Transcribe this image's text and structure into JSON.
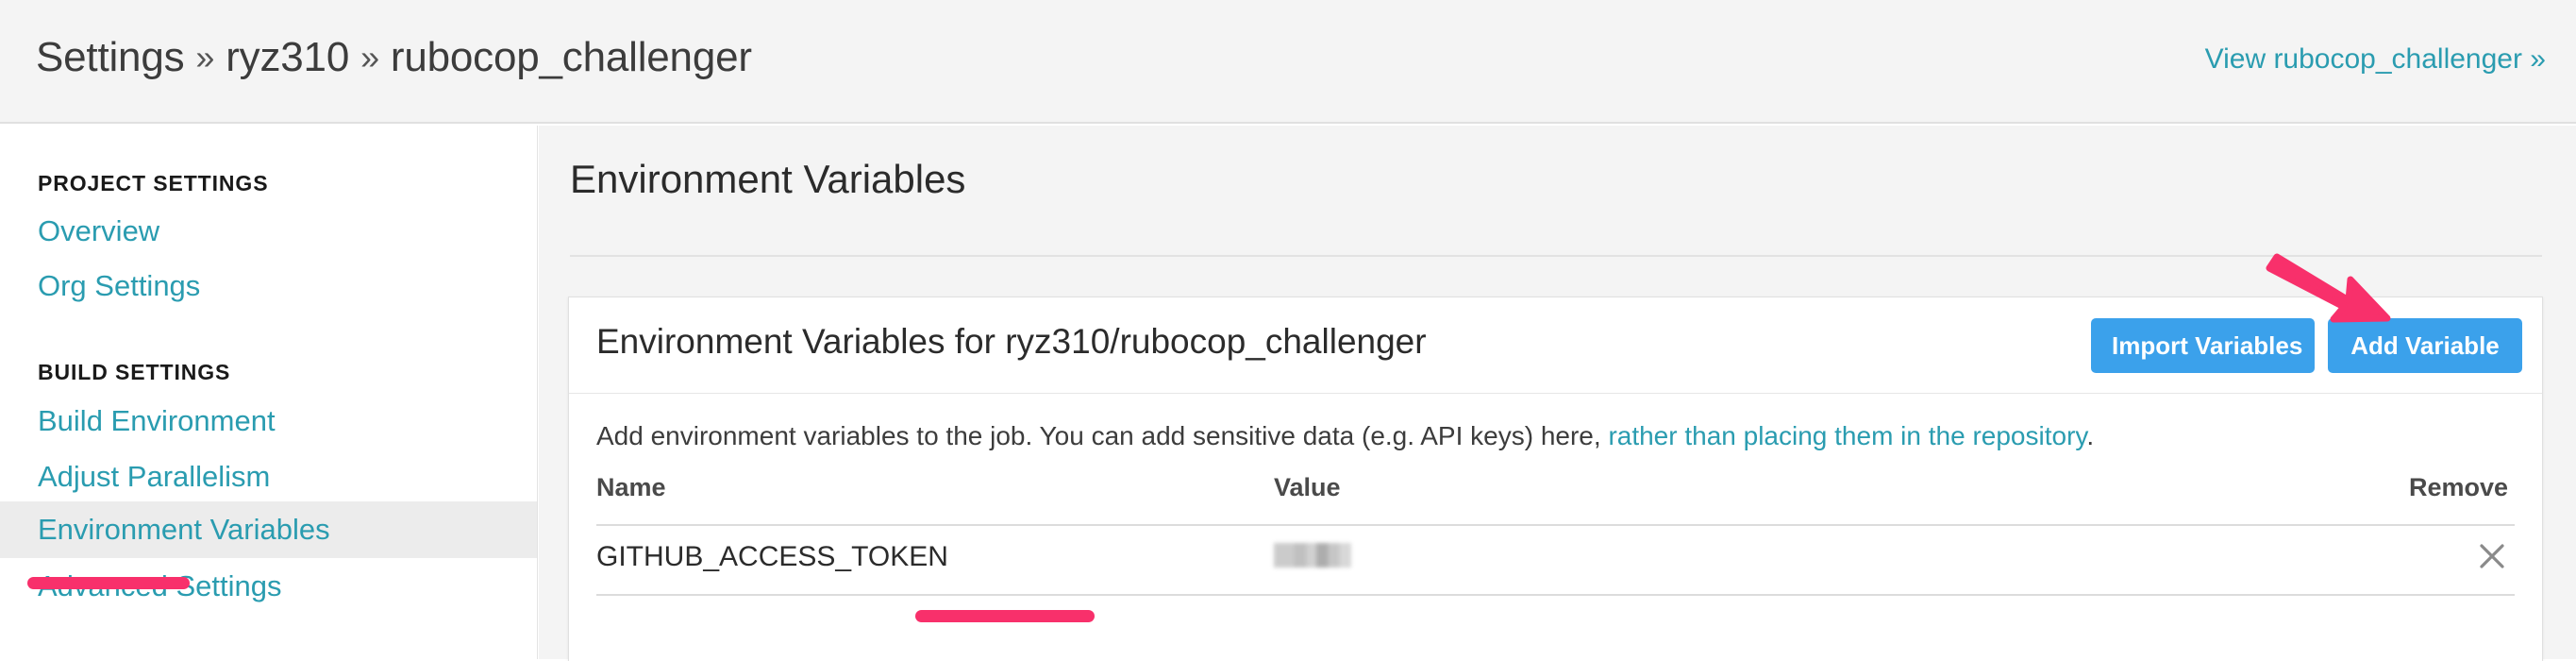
{
  "header": {
    "breadcrumb": {
      "items": [
        "Settings",
        "ryz310",
        "rubocop_challenger"
      ],
      "separator": "»"
    },
    "view_link": "View rubocop_challenger »"
  },
  "sidebar": {
    "groups": [
      {
        "title": "PROJECT SETTINGS",
        "items": [
          {
            "label": "Overview",
            "active": false
          },
          {
            "label": "Org Settings",
            "active": false
          }
        ]
      },
      {
        "title": "BUILD SETTINGS",
        "items": [
          {
            "label": "Build Environment",
            "active": false
          },
          {
            "label": "Adjust Parallelism",
            "active": false
          },
          {
            "label": "Environment Variables",
            "active": true
          },
          {
            "label": "Advanced Settings",
            "active": false
          }
        ]
      }
    ]
  },
  "main": {
    "page_title": "Environment Variables",
    "card": {
      "title": "Environment Variables for ryz310/rubocop_challenger",
      "import_button": "Import Variables",
      "add_button": "Add Variable",
      "description_before": "Add environment variables to the job. You can add sensitive data (e.g. API keys) here, ",
      "description_link": "rather than placing them in the repository",
      "description_after": ".",
      "table": {
        "columns": [
          "Name",
          "Value",
          "Remove"
        ],
        "rows": [
          {
            "name": "GITHUB_ACCESS_TOKEN",
            "value": "",
            "value_masked": true,
            "remove_icon": "close-icon"
          }
        ]
      }
    }
  },
  "annotations": {
    "highlight_color": "#f8306b",
    "arrow": {
      "name": "pink-arrow-annotation",
      "points_to": "Add Variable"
    },
    "underlines": [
      {
        "target": "Environment Variables"
      },
      {
        "target": "GITHUB_ACCESS_TOKEN"
      }
    ]
  },
  "colors": {
    "link": "#2a9cb0",
    "button": "#3ba1eb",
    "page_bg": "#f4f4f4",
    "accent_pink": "#f8306b"
  }
}
